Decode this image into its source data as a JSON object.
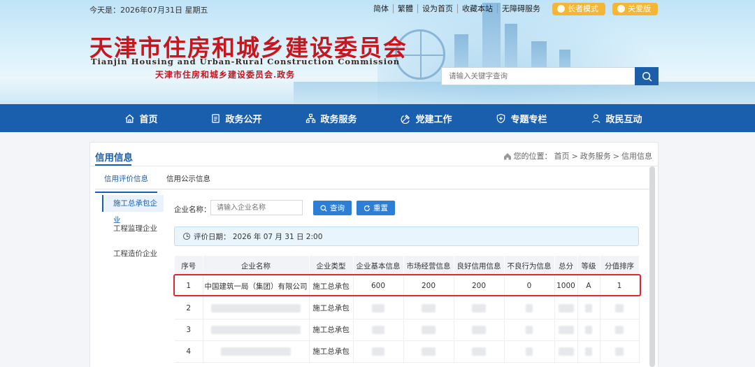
{
  "header": {
    "date_text": "今天是：2026年07月31日 星期五",
    "links": [
      "简体",
      "繁體",
      "设为首页",
      "收藏本站",
      "无障碍服务"
    ],
    "elder_mode": "长者模式",
    "care_edition": "关爱版",
    "site_name_cn": "天津市住房和城乡建设委员会",
    "site_name_en": "Tianjin Housing and Urban-Rural Construction Commission",
    "site_subtitle": "天津市住房和城乡建设委员会.政务",
    "search_placeholder": "请输入关键字查询"
  },
  "nav": {
    "items": [
      "首页",
      "政务公开",
      "政务服务",
      "党建工作",
      "专题专栏",
      "政民互动"
    ]
  },
  "panel": {
    "title": "信用信息",
    "breadcrumb": {
      "prefix": "您的位置：",
      "items": [
        "首页",
        "政务服务",
        "信用信息"
      ],
      "separator": ">"
    },
    "tabs": [
      "信用评价信息",
      "信用公示信息"
    ],
    "sidebar": [
      "施工总承包企业",
      "工程监理企业",
      "工程造价企业"
    ],
    "form": {
      "label": "企业名称：",
      "placeholder": "请输入企业名称",
      "query_button": "查询",
      "reset_button": "重置"
    },
    "eval_date": "评价日期：  2026 年 07 月 31 日 2:00",
    "table": {
      "headers": [
        "序号",
        "企业名称",
        "企业类型",
        "企业基本信息",
        "市场经营信息",
        "良好信用信息",
        "不良行为信息",
        "总分",
        "等级",
        "分值排序"
      ],
      "rows": [
        [
          "1",
          "中国建筑一局（集团）有限公司",
          "施工总承包",
          "600",
          "200",
          "200",
          "0",
          "1000",
          "A",
          "1"
        ],
        [
          "2",
          "",
          "施工总承包",
          "",
          "",
          "",
          "",
          "",
          "",
          ""
        ],
        [
          "3",
          "",
          "施工总承包",
          "",
          "",
          "",
          "",
          "",
          "",
          ""
        ],
        [
          "4",
          "",
          "施工总承包",
          "",
          "",
          "",
          "",
          "",
          "",
          ""
        ]
      ]
    }
  },
  "colors": {
    "nav_blue": "#1a5fae",
    "accent_red": "#c8161d",
    "highlight_red": "#e0272d",
    "button_blue": "#2d7fd6",
    "pill_orange": "#f4b638"
  }
}
